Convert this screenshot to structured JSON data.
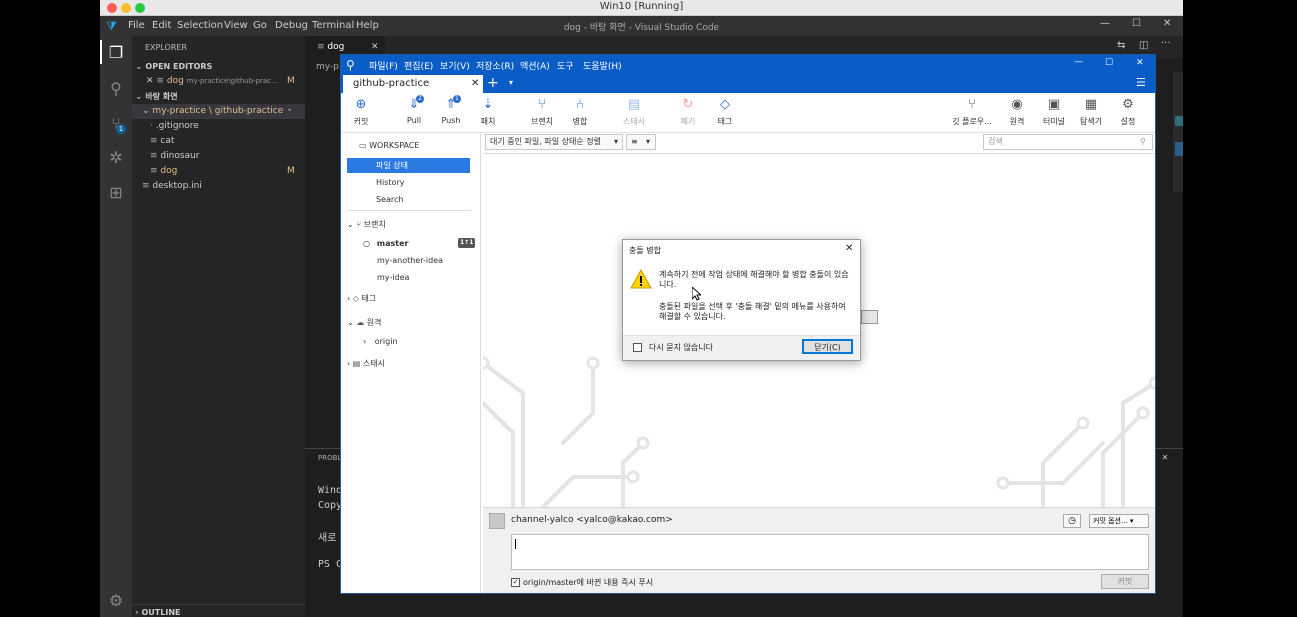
{
  "mac": {
    "title": "Win10 [Running]"
  },
  "vscode": {
    "menu": [
      "File",
      "Edit",
      "Selection",
      "View",
      "Go",
      "Debug",
      "Terminal",
      "Help"
    ],
    "window_title": "dog - 바탕 화면 - Visual Studio Code",
    "explorer": {
      "header": "EXPLORER",
      "open_editors_label": "OPEN EDITORS",
      "open_editor_file": "dog",
      "open_editor_path": "my-practice\\github-prac...",
      "open_editor_status": "M",
      "folder_label": "바탕 화면",
      "repo_label": "my-practice \\ github-practice",
      "files": [
        {
          "name": ".gitignore",
          "status": ""
        },
        {
          "name": "cat",
          "status": ""
        },
        {
          "name": "dinosaur",
          "status": ""
        },
        {
          "name": "dog",
          "status": "M"
        }
      ],
      "desktop_ini": "desktop.ini",
      "outline_label": "OUTLINE"
    },
    "tab": {
      "label": "dog"
    },
    "breadcrumb_fragment": "my-p",
    "panel": {
      "header_fragment": "PROBL",
      "lines": [
        "Wind",
        "Copy",
        "새로",
        "PS C"
      ]
    },
    "scm_badge": "1"
  },
  "sourcetree": {
    "menu": [
      "파일(F)",
      "편집(E)",
      "보기(V)",
      "저장소(R)",
      "액션(A)",
      "도구",
      "도움말(H)"
    ],
    "tab_label": "github-practice",
    "toolbar": {
      "left": [
        {
          "label": "커밋",
          "icon": "commit-icon",
          "badge": "",
          "disabled": false
        },
        {
          "label": "Pull",
          "icon": "pull-icon",
          "badge": "2",
          "disabled": false
        },
        {
          "label": "Push",
          "icon": "push-icon",
          "badge": "1",
          "disabled": false
        },
        {
          "label": "패치",
          "icon": "fetch-icon",
          "badge": "",
          "disabled": false
        },
        {
          "label": "브랜치",
          "icon": "branch-icon",
          "badge": "",
          "disabled": false
        },
        {
          "label": "병합",
          "icon": "merge-icon",
          "badge": "",
          "disabled": false
        },
        {
          "label": "스태시",
          "icon": "stash-icon",
          "badge": "",
          "disabled": true
        },
        {
          "label": "폐기",
          "icon": "discard-icon",
          "badge": "",
          "disabled": true
        },
        {
          "label": "태그",
          "icon": "tag-icon",
          "badge": "",
          "disabled": false
        }
      ],
      "right": [
        {
          "label": "깃 플로우...",
          "icon": "git-flow-icon"
        },
        {
          "label": "원격",
          "icon": "globe-icon"
        },
        {
          "label": "터미널",
          "icon": "terminal-icon"
        },
        {
          "label": "탐색기",
          "icon": "explorer-icon"
        },
        {
          "label": "설정",
          "icon": "gear-icon"
        }
      ]
    },
    "sidebar": {
      "workspace_label": "WORKSPACE",
      "workspace_items": [
        "파일 상태",
        "History",
        "Search"
      ],
      "branches_label": "브랜치",
      "branches": [
        {
          "name": "master",
          "current": true,
          "badge": "1↑1"
        },
        {
          "name": "my-another-idea",
          "current": false,
          "badge": ""
        },
        {
          "name": "my-idea",
          "current": false,
          "badge": ""
        }
      ],
      "tags_label": "태그",
      "remotes_label": "원격",
      "remotes": [
        "origin"
      ],
      "stashes_label": "스태시"
    },
    "filter_select": "대기 중인 파일, 파일 상태순 정렬",
    "list_select": "≡",
    "search_placeholder": "검색",
    "author": "channel-yalco <yalco@kakao.com>",
    "commit_options": "커밋 옵션...",
    "push_checkbox_label": "origin/master에 바뀐 내용 즉시 푸시",
    "commit_button": "커밋"
  },
  "dialog": {
    "title": "충돌 병합",
    "message1": "계속하기 전에 작업 상태에 해결해야 할 병합 충돌이 있습니다.",
    "message2": "충돌된 파일을 선택 후 '충돌 해결' 밑의 메뉴를 사용하여 해결할 수 있습니다.",
    "checkbox_label": "다시 묻지 않습니다",
    "close_button": "닫기(C)"
  }
}
